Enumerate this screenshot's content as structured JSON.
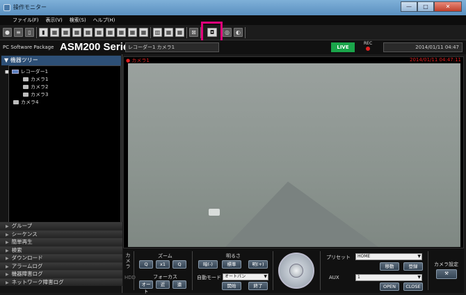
{
  "window": {
    "title": "操作モニター",
    "min": "—",
    "max": "□",
    "close": "✕"
  },
  "menu": [
    "ファイル(F)",
    "表示(V)",
    "検索(S)",
    "ヘルプ(H)"
  ],
  "brand": {
    "small": "PC Software Package",
    "big": "ASM200 Series"
  },
  "status": {
    "camera_name": "レコーダー1 カメラ1",
    "live": "LIVE",
    "rec": "REC",
    "date": "2014/01/11 04:47"
  },
  "tree": {
    "header": "機器ツリー",
    "recorder": "レコーダー1",
    "cameras": [
      "カメラ1",
      "カメラ2",
      "カメラ3"
    ],
    "extra_camera": "カメラ4"
  },
  "nav": [
    "グループ",
    "シーケンス",
    "簡単再生",
    "検索",
    "ダウンロード",
    "アラームログ",
    "機器障害ログ",
    "ネットワーク障害ログ"
  ],
  "video": {
    "label": "カメラ1",
    "timestamp": "2014/01/11 04:47:11"
  },
  "controls": {
    "tab_camera": "カメラ",
    "tab_hdd": "HDD",
    "zoom_label": "ズーム",
    "zoom_out": "Q",
    "zoom_x1": "x1",
    "zoom_in": "Q",
    "focus_label": "フォーカス",
    "focus_auto": "オート",
    "focus_near": "近",
    "focus_far": "遠",
    "brightness_label": "明るさ",
    "bright_minus": "暗(-)",
    "bright_standard": "標準",
    "bright_plus": "明(+)",
    "auto_mode_label": "自動モード",
    "auto_mode_value": "オートパン",
    "start": "開始",
    "end": "終了",
    "preset_label": "プリセット",
    "preset_value": "HOME",
    "move": "移動",
    "register": "登録",
    "aux_label": "AUX",
    "aux_value": "1",
    "open": "OPEN",
    "close": "CLOSE",
    "camera_settings": "カメラ設定"
  }
}
